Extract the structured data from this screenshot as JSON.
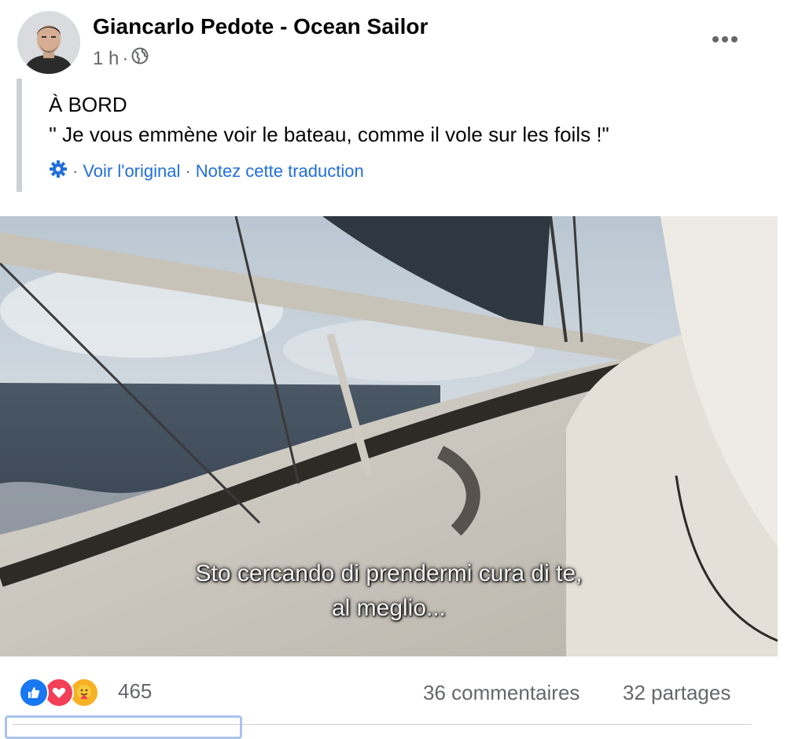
{
  "post": {
    "author": "Giancarlo Pedote - Ocean Sailor",
    "time": "1 h",
    "separator": "·",
    "privacy_icon": "globe-icon",
    "more_icon": "more-options-icon",
    "text_lines": [
      "À BORD",
      "'' Je vous emmène voir le bateau, comme il vole sur les foils !\""
    ],
    "translation": {
      "icon": "gear-icon",
      "separator": "·",
      "see_original": "Voir l'original",
      "rate_translation": "Notez cette traduction"
    }
  },
  "video": {
    "subtitle_lines": [
      "Sto cercando di prendermi cura di te,",
      "al meglio..."
    ]
  },
  "footer": {
    "reactions": [
      "like-icon",
      "love-icon",
      "care-icon"
    ],
    "reaction_count": "465",
    "comments": "36 commentaires",
    "shares": "32 partages"
  },
  "colors": {
    "link": "#216fdb",
    "secondary_text": "#65676b",
    "like": "#1877f2",
    "love": "#f33e58",
    "care": "#f7b125"
  }
}
